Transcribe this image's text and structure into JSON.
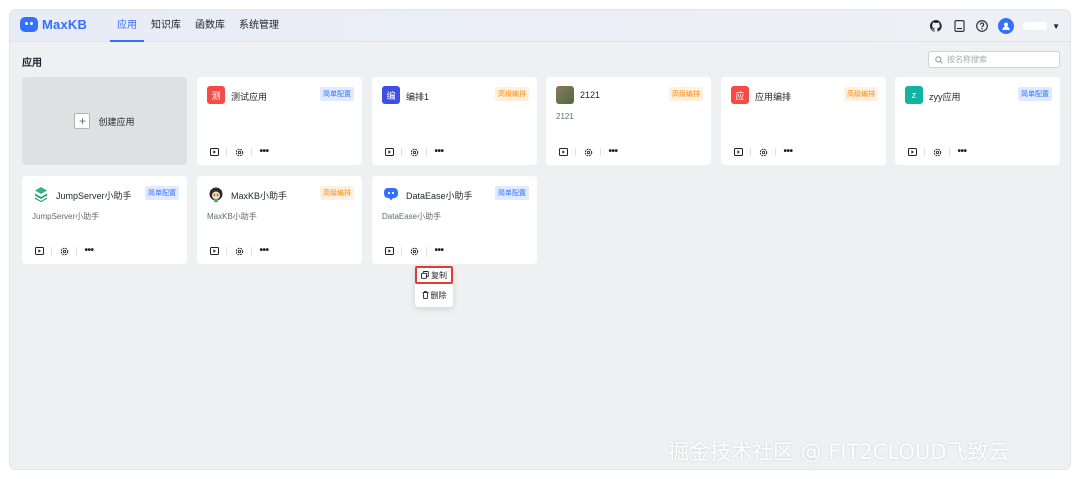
{
  "app": {
    "brand": "MaxKB",
    "brand_color": "#3370ff"
  },
  "nav": [
    {
      "label": "应用",
      "active": true
    },
    {
      "label": "知识库",
      "active": false
    },
    {
      "label": "函数库",
      "active": false
    },
    {
      "label": "系统管理",
      "active": false
    }
  ],
  "header_tools": [
    "github-icon",
    "document-icon",
    "help-icon",
    "user-avatar"
  ],
  "page": {
    "title": "应用"
  },
  "search": {
    "placeholder": "按名称搜索",
    "value": ""
  },
  "create": {
    "label": "创建应用"
  },
  "apps": [
    {
      "name": "测试应用",
      "icon_text": "测",
      "icon_color": "#f54a45",
      "tag": "简单配置",
      "tag_type": "simple",
      "desc": ""
    },
    {
      "name": "编排1",
      "icon_text": "编",
      "icon_color": "#3f50e0",
      "tag": "高级编排",
      "tag_type": "advanced",
      "desc": ""
    },
    {
      "name": "2121",
      "icon_text": "",
      "icon_color": "#7a6a55",
      "tag": "高级编排",
      "tag_type": "advanced",
      "desc": "2121"
    },
    {
      "name": "应用编排",
      "icon_text": "应",
      "icon_color": "#f54a45",
      "tag": "高级编排",
      "tag_type": "advanced",
      "desc": ""
    },
    {
      "name": "zyy应用",
      "icon_text": "z",
      "icon_color": "#14b3a1",
      "tag": "简单配置",
      "tag_type": "simple",
      "desc": ""
    },
    {
      "name": "JumpServer小助手",
      "icon_text": "",
      "icon_color": "#2cb87a",
      "tag": "简单配置",
      "tag_type": "simple",
      "desc": "JumpServer小助手"
    },
    {
      "name": "MaxKB小助手",
      "icon_text": "",
      "icon_color": "#2b2b2b",
      "tag": "高级编排",
      "tag_type": "advanced",
      "desc": "MaxKB小助手"
    },
    {
      "name": "DataEase小助手",
      "icon_text": "",
      "icon_color": "#3370ff",
      "tag": "简单配置",
      "tag_type": "simple",
      "desc": "DataEase小助手"
    }
  ],
  "context_menu": {
    "copy": "复制",
    "delete": "删除"
  },
  "watermark": "掘金技术社区 @ FIT2CLOUD飞致云"
}
